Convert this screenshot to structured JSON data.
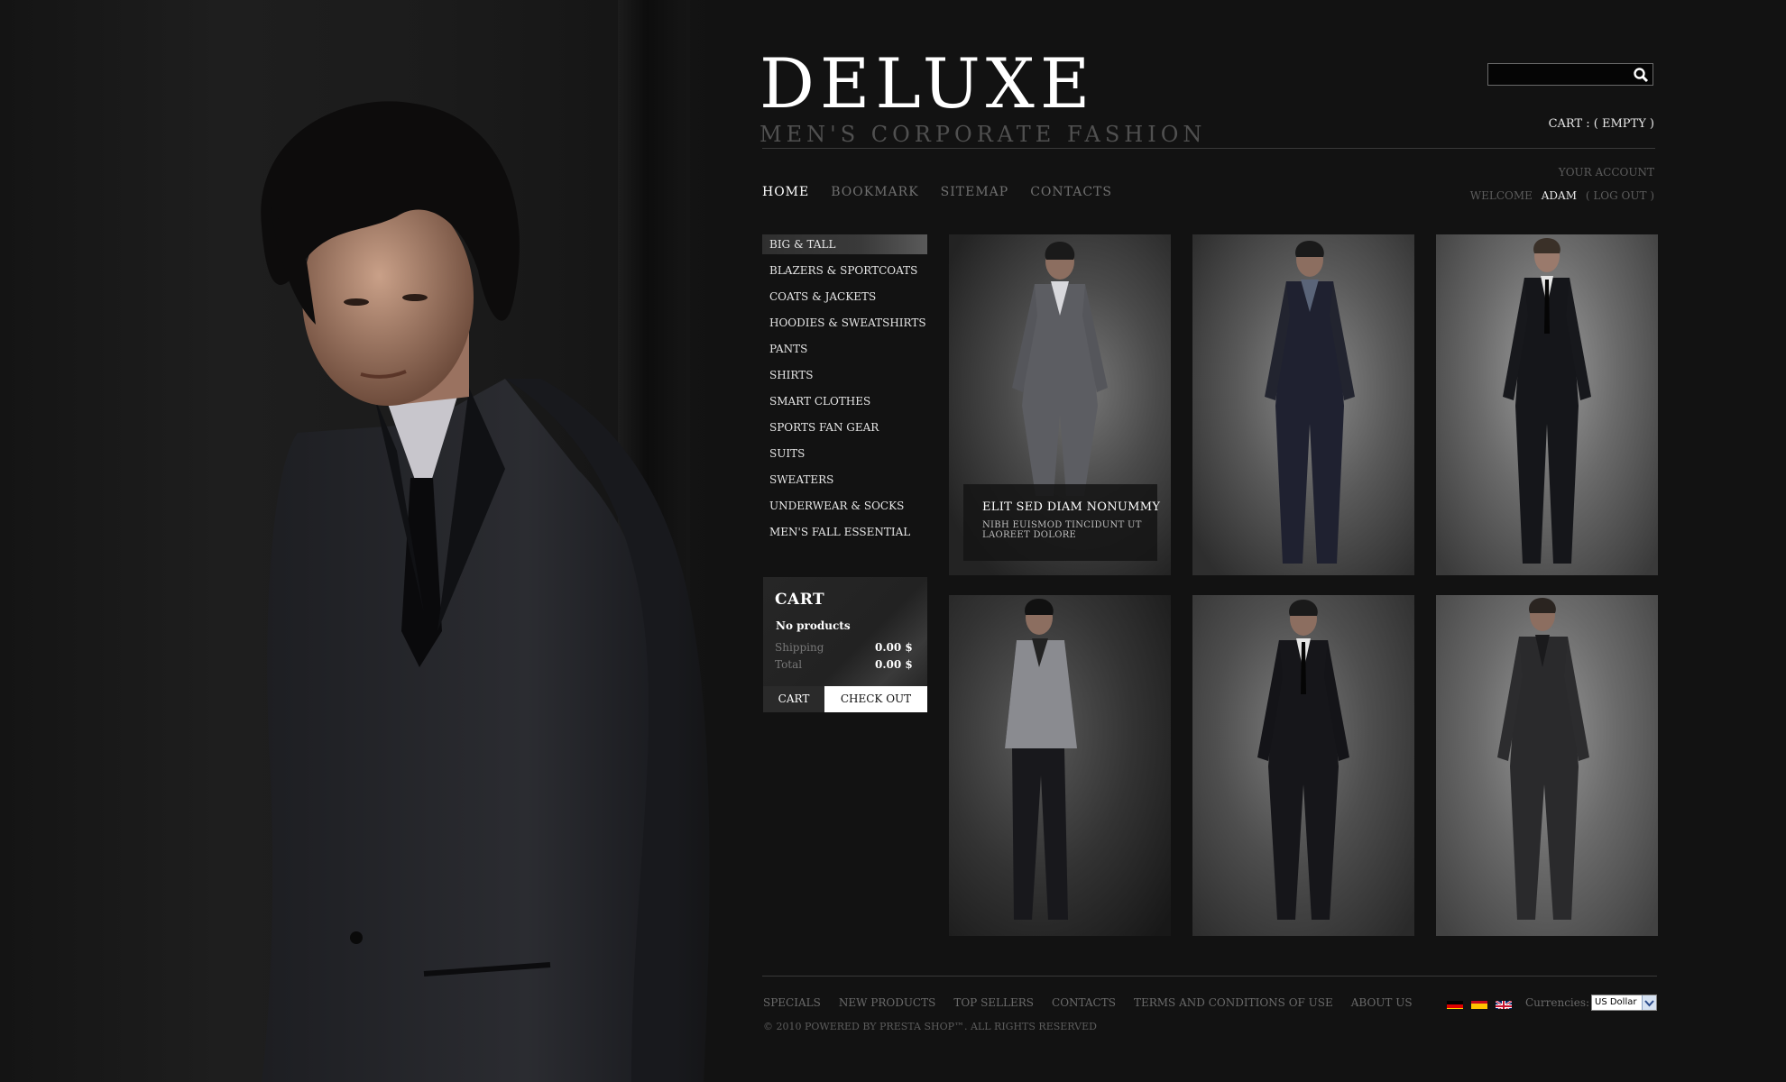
{
  "brand": {
    "title": "DELUXE",
    "subtitle": "MEN'S CORPORATE FASHION"
  },
  "search": {
    "placeholder": "",
    "value": ""
  },
  "cart_top": "CART : ( EMPTY )",
  "nav": [
    {
      "label": "HOME",
      "active": true
    },
    {
      "label": "BOOKMARK",
      "active": false
    },
    {
      "label": "SITEMAP",
      "active": false
    },
    {
      "label": "CONTACTS",
      "active": false
    }
  ],
  "account": {
    "link": "YOUR ACCOUNT",
    "welcome": "WELCOME",
    "user": "ADAM",
    "logout": "( LOG OUT )"
  },
  "categories": [
    "BIG & TALL",
    "BLAZERS & SPORTCOATS",
    "COATS & JACKETS",
    "HOODIES & SWEATSHIRTS",
    "PANTS",
    "SHIRTS",
    "SMART CLOTHES",
    "SPORTS FAN GEAR",
    "SUITS",
    "SWEATERS",
    "UNDERWEAR & SOCKS",
    "MEN'S FALL ESSENTIAL"
  ],
  "cart": {
    "title": "CART",
    "empty_text": "No products",
    "shipping_label": "Shipping",
    "shipping_value": "0.00 $",
    "total_label": "Total",
    "total_value": "0.00 $",
    "cart_button": "CART",
    "checkout_button": "CHECK OUT"
  },
  "featured_caption": {
    "title": "ELIT SED DIAM NONUMMY",
    "text": "NIBH EUISMOD TINCIDUNT UT LAOREET DOLORE"
  },
  "footer": {
    "links": [
      "SPECIALS",
      "NEW PRODUCTS",
      "TOP SELLERS",
      "CONTACTS",
      "TERMS AND CONDITIONS OF USE",
      "ABOUT US"
    ],
    "copyright": "© 2010 POWERED BY PRESTA SHOP™.  ALL RIGHTS RESERVED",
    "currency_label": "Currencies:",
    "currency_value": "US Dollar",
    "languages": [
      "de-flag-icon",
      "es-flag-icon",
      "uk-flag-icon"
    ]
  },
  "colors": {
    "background": "#121212",
    "text": "#ffffff",
    "muted": "#6f6f6f",
    "accent": "#ffffff"
  }
}
